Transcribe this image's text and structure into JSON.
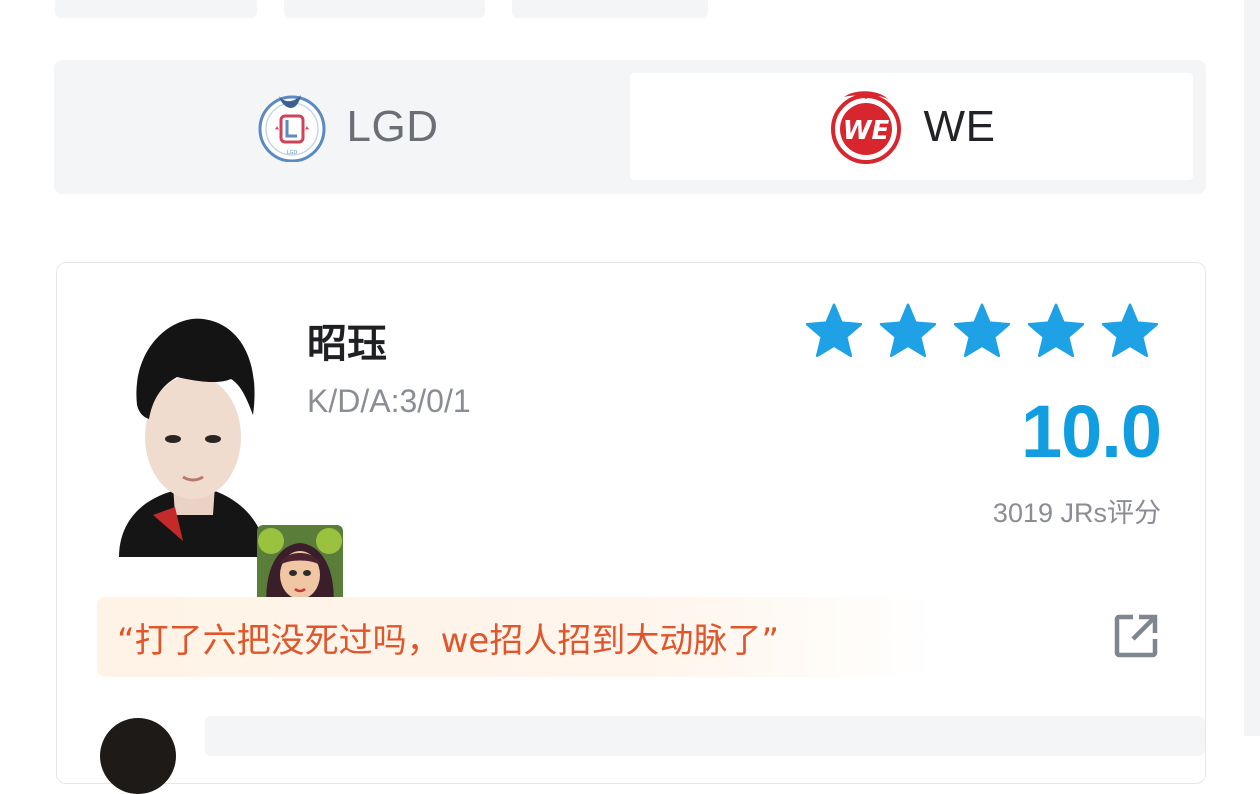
{
  "teams": {
    "left": {
      "name": "LGD",
      "logo_text": "LGD",
      "colors": {
        "ring": "#5a8ac0",
        "accent": "#d1425a"
      }
    },
    "right": {
      "name": "WE",
      "logo_text": "WE",
      "colors": {
        "primary": "#d8262f"
      }
    },
    "active": "WE"
  },
  "player": {
    "name": "昭珏",
    "kda": "K/D/A:3/0/1",
    "rating_stars": 5,
    "rating_max": 5,
    "score": "10.0",
    "votes": "3019 JRs评分",
    "comment": "“打了六把没死过吗，we招人招到大动脉了”"
  },
  "colors": {
    "star": "#1fa1e6",
    "score": "#109ee0",
    "quote_text": "#e0552a",
    "quote_bg": "#fff3e7",
    "panel_bg": "#f4f5f7"
  },
  "icons": {
    "share": "external-link-icon",
    "star": "star-icon"
  }
}
